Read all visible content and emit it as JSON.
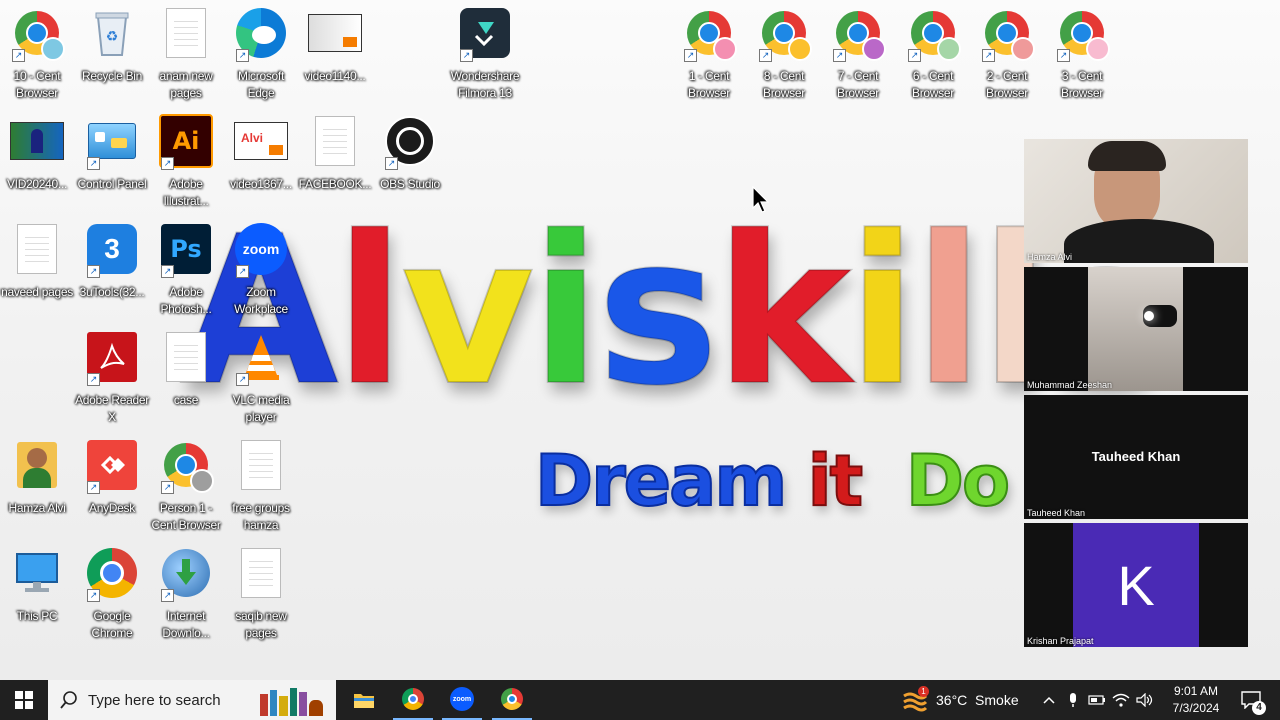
{
  "desktop": {
    "brand_text": "Alviskills",
    "tagline_primary": "Dream it",
    "tagline_secondary": "Do it",
    "icons": [
      {
        "label": "10 - Cent Browser"
      },
      {
        "label": "Recycle Bin"
      },
      {
        "label": "anam new pages"
      },
      {
        "label": "Microsoft Edge"
      },
      {
        "label": "video1140..."
      },
      {
        "label": "Wondershare Filmora 13"
      },
      {
        "label": "1 - Cent Browser"
      },
      {
        "label": "8 - Cent Browser"
      },
      {
        "label": "7 - Cent Browser"
      },
      {
        "label": "6 - Cent Browser"
      },
      {
        "label": "2 - Cent Browser"
      },
      {
        "label": "3 - Cent Browser"
      },
      {
        "label": "VID20240..."
      },
      {
        "label": "Control Panel"
      },
      {
        "label": "Adobe Illustrat..."
      },
      {
        "label": "video1367..."
      },
      {
        "label": "FACEBOOK..."
      },
      {
        "label": "OBS Studio"
      },
      {
        "label": "naveed pages"
      },
      {
        "label": "3uTools(32..."
      },
      {
        "label": "Adobe Photosh..."
      },
      {
        "label": "Zoom Workplace"
      },
      {
        "label": "Adobe Reader X"
      },
      {
        "label": "case"
      },
      {
        "label": "VLC media player"
      },
      {
        "label": "Hamza Alvi"
      },
      {
        "label": "AnyDesk"
      },
      {
        "label": "Person 1 - Cent Browser"
      },
      {
        "label": "free groups hamza"
      },
      {
        "label": "This PC"
      },
      {
        "label": "Google Chrome"
      },
      {
        "label": "Internet Downlo..."
      },
      {
        "label": "saqib new pages"
      }
    ],
    "app_glyphs": {
      "illustrator": "Ai",
      "photoshop": "Ps",
      "zoom": "zoom",
      "avatar_letter": "K"
    }
  },
  "meeting": {
    "participants": [
      {
        "name": "Hamza Alvi"
      },
      {
        "name": "Muhammad Zeeshan"
      },
      {
        "name": "Tauheed Khan",
        "center_label": "Tauheed Khan"
      },
      {
        "name": "Krishan Prajapat"
      }
    ]
  },
  "taskbar": {
    "search_placeholder": "Type here to search",
    "weather": "36°C  Smoke",
    "weather_badge": "1",
    "time": "9:01 AM",
    "date": "7/3/2024",
    "notification_count": "4"
  },
  "colors": {
    "taskbar_bg": "#202020",
    "zoom_blue": "#0b5cff",
    "avatar_purple": "#4a2ab5"
  }
}
